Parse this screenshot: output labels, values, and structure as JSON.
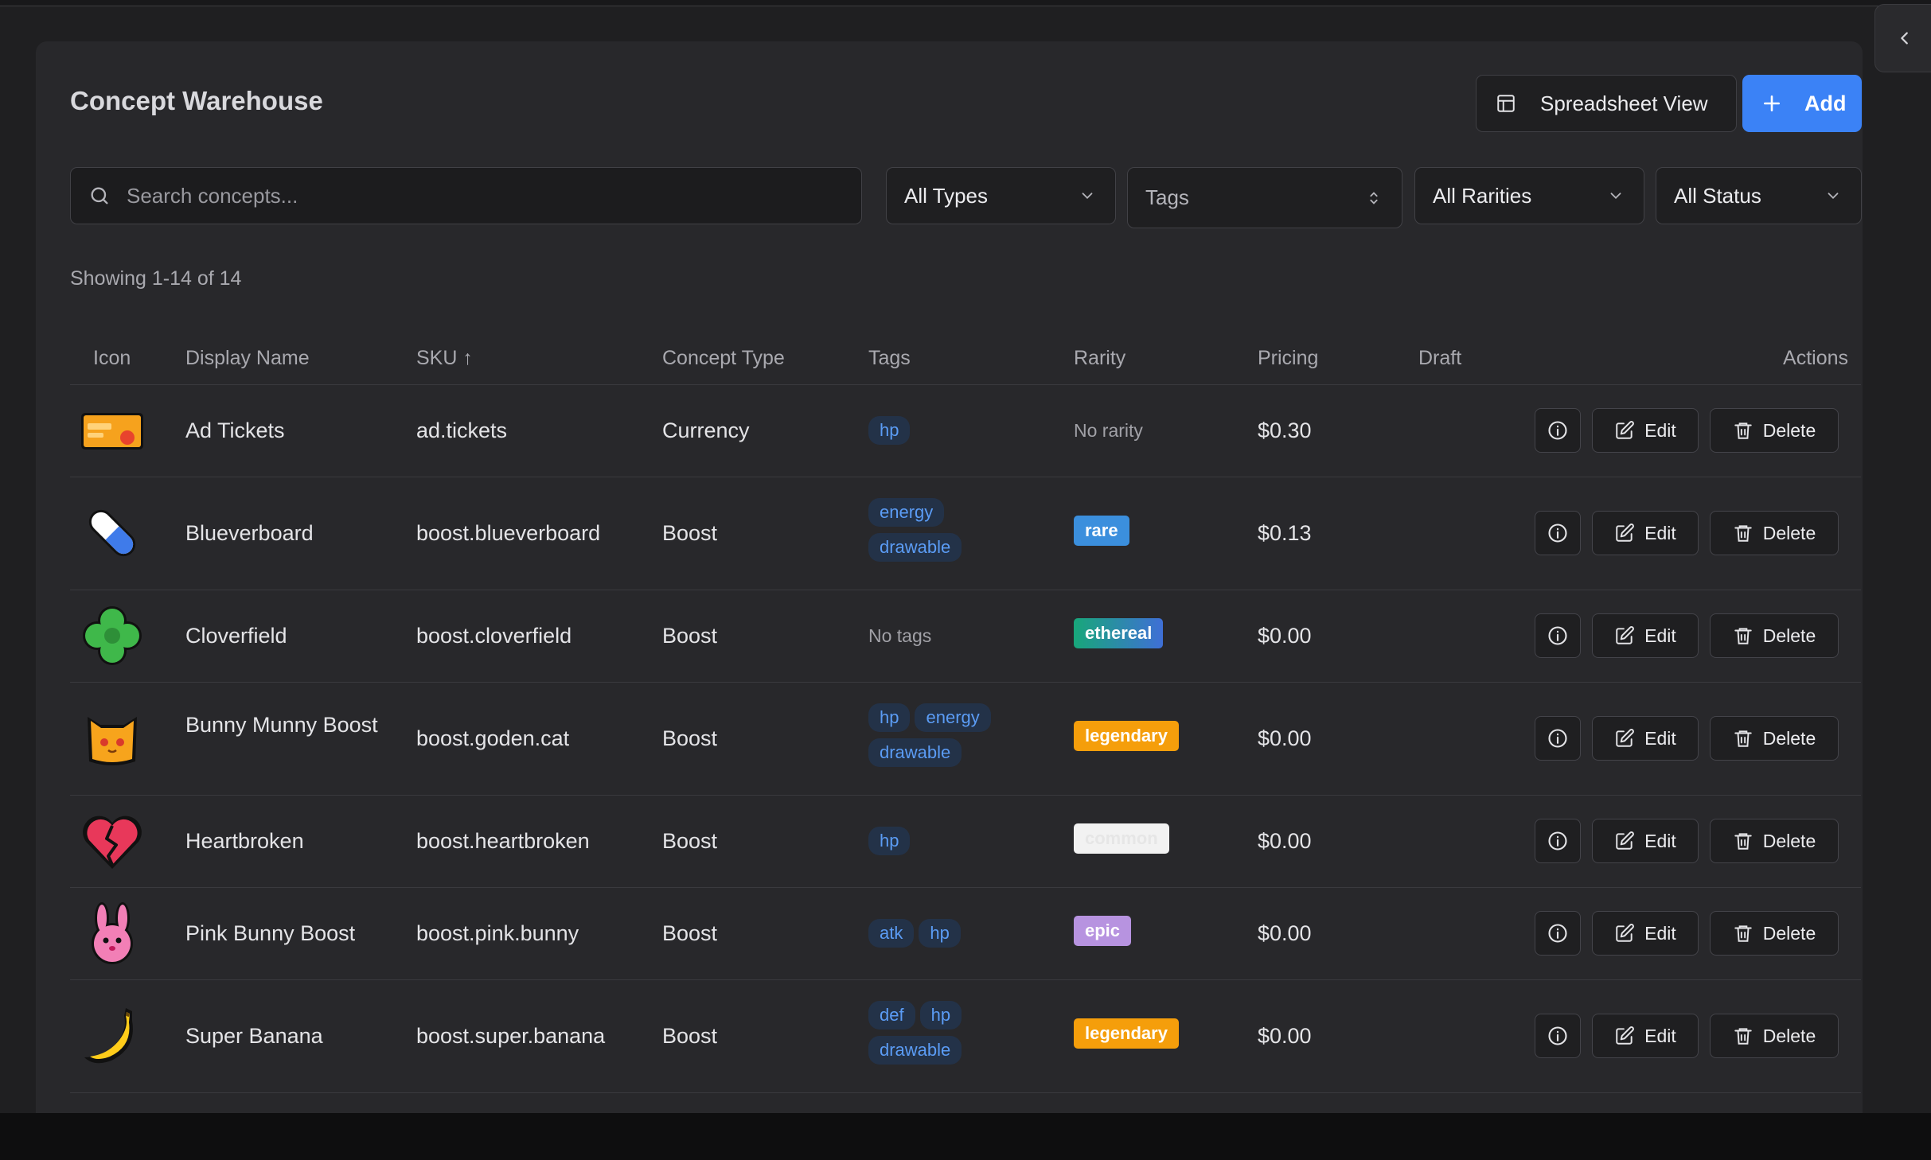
{
  "header": {
    "title": "Concept Warehouse",
    "spreadsheet_label": "Spreadsheet View",
    "add_label": "Add"
  },
  "filters": {
    "search_placeholder": "Search concepts...",
    "types": "All Types",
    "tags": "Tags",
    "rarities": "All Rarities",
    "status": "All Status"
  },
  "showing": "Showing 1-14 of 14",
  "columns": {
    "icon": "Icon",
    "display_name": "Display Name",
    "sku": "SKU ↑",
    "concept_type": "Concept Type",
    "tags": "Tags",
    "rarity": "Rarity",
    "pricing": "Pricing",
    "draft": "Draft",
    "actions": "Actions"
  },
  "actions": {
    "edit": "Edit",
    "delete": "Delete"
  },
  "rows": [
    {
      "icon": "ticket-icon",
      "name": "Ad Tickets",
      "sku": "ad.tickets",
      "type": "Currency",
      "tags": [
        "hp"
      ],
      "rarity": "",
      "rarity_placeholder": "No rarity",
      "price": "$0.30"
    },
    {
      "icon": "pill-icon",
      "name": "Blueverboard",
      "sku": "boost.blueverboard",
      "type": "Boost",
      "tags": [
        "energy",
        "drawable"
      ],
      "rarity": "rare",
      "price": "$0.13"
    },
    {
      "icon": "clover-icon",
      "name": "Cloverfield",
      "sku": "boost.cloverfield",
      "type": "Boost",
      "tags": [],
      "tags_placeholder": "No tags",
      "rarity": "ethereal",
      "price": "$0.00"
    },
    {
      "icon": "cat-icon",
      "name": "Bunny Munny Boost",
      "sku": "boost.goden.cat",
      "type": "Boost",
      "tags": [
        "hp",
        "energy",
        "drawable"
      ],
      "rarity": "legendary",
      "price": "$0.00"
    },
    {
      "icon": "broken-heart-icon",
      "name": "Heartbroken",
      "sku": "boost.heartbroken",
      "type": "Boost",
      "tags": [
        "hp"
      ],
      "rarity": "common",
      "price": "$0.00"
    },
    {
      "icon": "bunny-icon",
      "name": "Pink Bunny Boost",
      "sku": "boost.pink.bunny",
      "type": "Boost",
      "tags": [
        "atk",
        "hp"
      ],
      "rarity": "epic",
      "price": "$0.00"
    },
    {
      "icon": "banana-icon",
      "name": "Super Banana",
      "sku": "boost.super.banana",
      "type": "Boost",
      "tags": [
        "def",
        "hp",
        "drawable"
      ],
      "rarity": "legendary",
      "price": "$0.00"
    }
  ],
  "colors": {
    "accent": "#3b82f6",
    "rare": "#3b8fdd",
    "legendary": "#f59e0b",
    "epic": "#b793e0",
    "common": "#f2f2f2",
    "tag_text": "#5b9cf5"
  }
}
